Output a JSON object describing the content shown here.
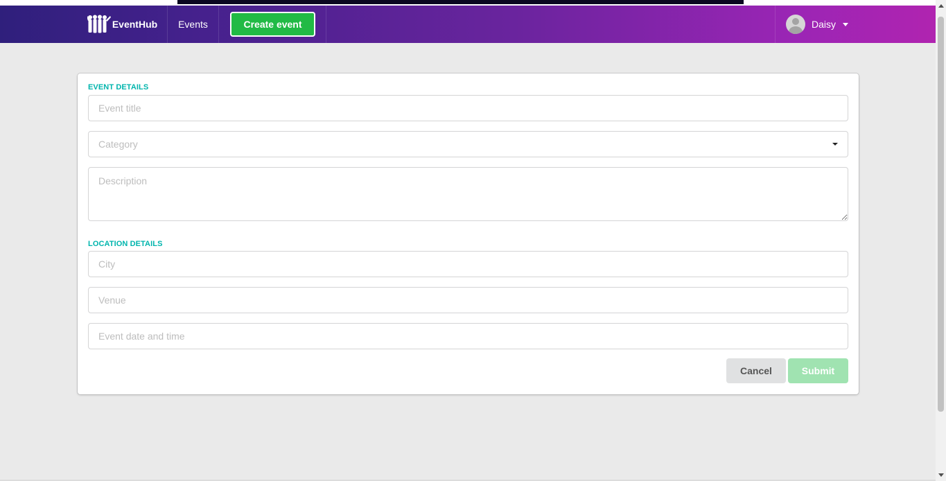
{
  "navbar": {
    "brand": "EventHub",
    "events_label": "Events",
    "create_label": "Create event",
    "user_name": "Daisy"
  },
  "form": {
    "event_details_header": "EVENT DETAILS",
    "title_placeholder": "Event title",
    "category_placeholder": "Category",
    "description_placeholder": "Description",
    "location_details_header": "LOCATION DETAILS",
    "city_placeholder": "City",
    "venue_placeholder": "Venue",
    "date_placeholder": "Event date and time",
    "cancel_label": "Cancel",
    "submit_label": "Submit"
  },
  "colors": {
    "accent_teal": "#00b5ad",
    "create_green": "#21ba45",
    "submit_disabled": "#a0e3b1",
    "nav_gradient_start": "#2f1f7c",
    "nav_gradient_end": "#b024b0"
  },
  "icons": {
    "logo": "people-group-logo-icon",
    "user_caret": "caret-down-icon",
    "category_caret": "caret-down-icon"
  }
}
